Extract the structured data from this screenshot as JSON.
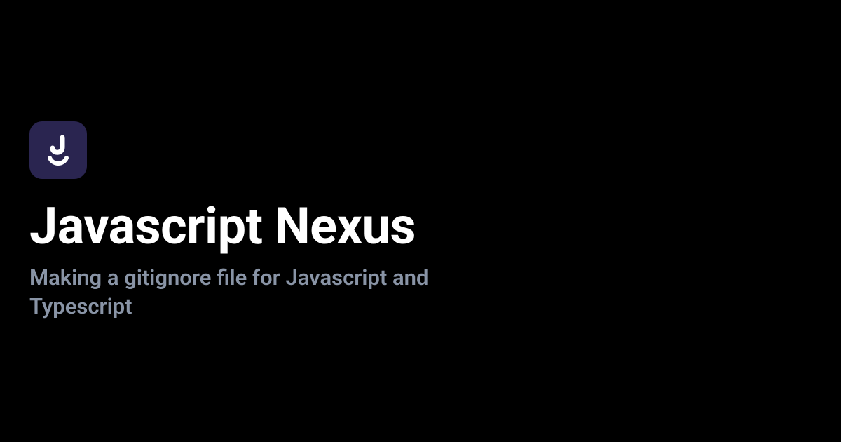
{
  "logo": {
    "name": "j-logo-icon",
    "bg_color": "#2a2550",
    "fg_color": "#ffffff"
  },
  "title": "Javascript Nexus",
  "subtitle": "Making a gitignore file for Javascript and Typescript"
}
